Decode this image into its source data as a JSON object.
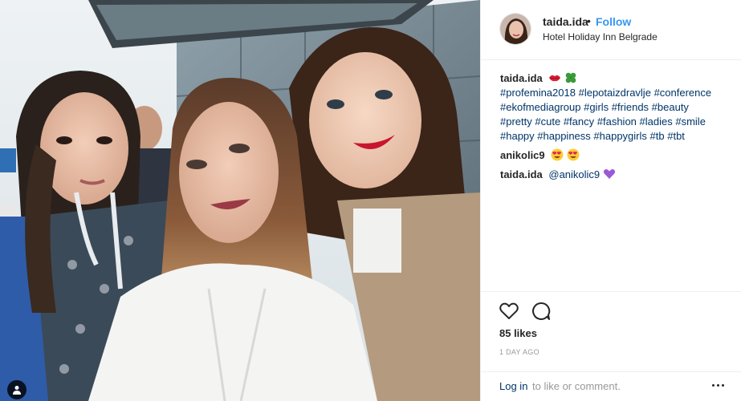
{
  "post": {
    "username": "taida.ida",
    "separator": "•",
    "follow_label": "Follow",
    "location": "Hotel Holiday Inn Belgrade"
  },
  "caption": {
    "username": "taida.ida",
    "hashtags": [
      "#profemina2018",
      "#lepotaizdravlje",
      "#conference",
      "#ekofmediagroup",
      "#girls",
      "#friends",
      "#beauty",
      "#pretty",
      "#cute",
      "#fancy",
      "#fashion",
      "#ladies",
      "#smile",
      "#happy",
      "#happiness",
      "#happygirls",
      "#tb",
      "#tbt"
    ]
  },
  "comments": [
    {
      "username": "anikolic9",
      "text": "",
      "emojis": [
        "heart-eyes-emoji",
        "heart-eyes-emoji"
      ]
    },
    {
      "username": "taida.ida",
      "mention": "@anikolic9",
      "emojis": [
        "purple-heart-emoji"
      ]
    }
  ],
  "actions": {
    "icons": [
      "heart-icon",
      "comment-icon"
    ],
    "likes": "85 likes",
    "timestamp": "1 DAY AGO"
  },
  "footer": {
    "login_label": "Log in",
    "login_rest": "to like or comment.",
    "more_icon": "more-options-icon"
  },
  "colors": {
    "link_blue": "#3897f0",
    "hashtag_navy": "#003569",
    "muted_gray": "#999999",
    "text": "#262626",
    "divider": "#efefef"
  }
}
